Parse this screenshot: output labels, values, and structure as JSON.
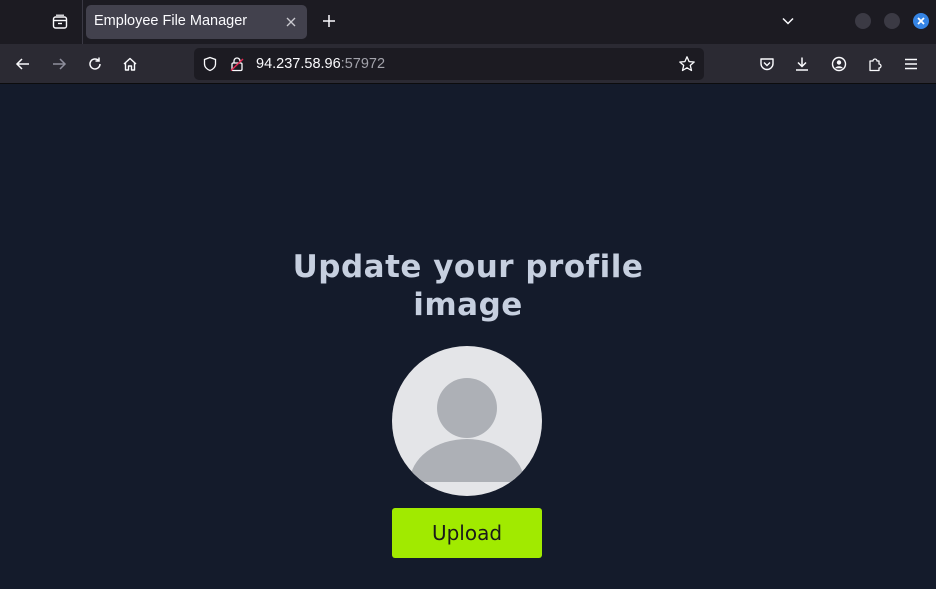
{
  "browser": {
    "tab": {
      "title": "Employee File Manager"
    },
    "url": {
      "host": "94.237.58.96",
      "port": ":57972"
    },
    "icons": {
      "tab_list": "tab-list-icon",
      "tab_close": "close-icon",
      "new_tab": "plus-icon",
      "tab_overflow": "chevron-down-icon",
      "back": "arrow-left-icon",
      "forward": "arrow-right-icon",
      "reload": "reload-icon",
      "home": "home-icon",
      "shield": "shield-icon",
      "lock": "insecure-lock-icon",
      "bookmark": "star-icon",
      "pocket": "pocket-icon",
      "downloads": "download-icon",
      "account": "account-icon",
      "extensions": "puzzle-icon",
      "menu": "hamburger-menu-icon"
    }
  },
  "page": {
    "heading": "Update your profile image",
    "upload_label": "Upload",
    "avatar_icon": "user-placeholder-icon"
  },
  "colors": {
    "page_background": "#141b2b",
    "heading_text": "#c6cfdf",
    "upload_button": "#a1ea00",
    "window_close": "#3584e4"
  }
}
